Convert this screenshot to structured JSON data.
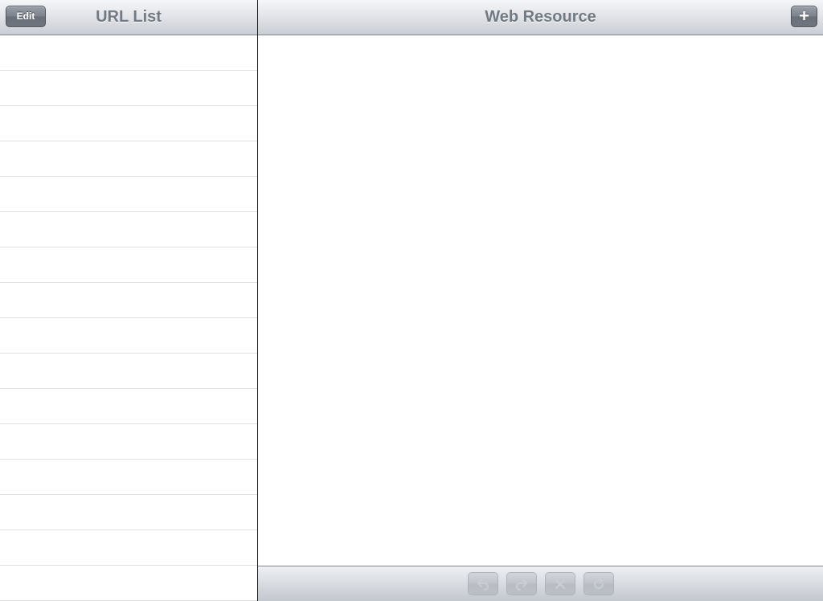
{
  "master": {
    "title": "URL List",
    "edit_label": "Edit",
    "row_count": 16
  },
  "detail": {
    "title": "Web Resource",
    "add_label": "+"
  },
  "toolbar": {
    "buttons": [
      {
        "name": "back",
        "icon": "undo-arrow-icon",
        "enabled": false
      },
      {
        "name": "forward",
        "icon": "redo-arrow-icon",
        "enabled": false
      },
      {
        "name": "stop",
        "icon": "close-icon",
        "enabled": false
      },
      {
        "name": "reload",
        "icon": "reload-icon",
        "enabled": false
      }
    ]
  },
  "colors": {
    "title_text": "#717983",
    "bar_button": "#7b818b",
    "divider": "#1c1c1c",
    "row_separator": "#e0e0e0"
  }
}
